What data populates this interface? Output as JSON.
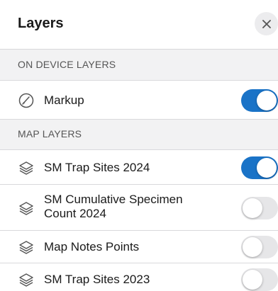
{
  "header": {
    "title": "Layers",
    "close_icon": "close-icon"
  },
  "sections": [
    {
      "label": "ON DEVICE LAYERS"
    },
    {
      "label": "MAP LAYERS"
    }
  ],
  "on_device_layers": [
    {
      "label": "Markup",
      "icon": "markup-icon",
      "enabled": true
    }
  ],
  "map_layers": [
    {
      "label": "SM Trap Sites 2024",
      "icon": "layers-icon",
      "enabled": true
    },
    {
      "label": "SM Cumulative Specimen Count 2024",
      "icon": "layers-icon",
      "enabled": false
    },
    {
      "label": "Map Notes Points",
      "icon": "layers-icon",
      "enabled": false
    },
    {
      "label": "SM Trap Sites 2023",
      "icon": "layers-icon",
      "enabled": false
    }
  ],
  "colors": {
    "toggle_on": "#1a73c7",
    "toggle_off": "#e6e6e8"
  }
}
